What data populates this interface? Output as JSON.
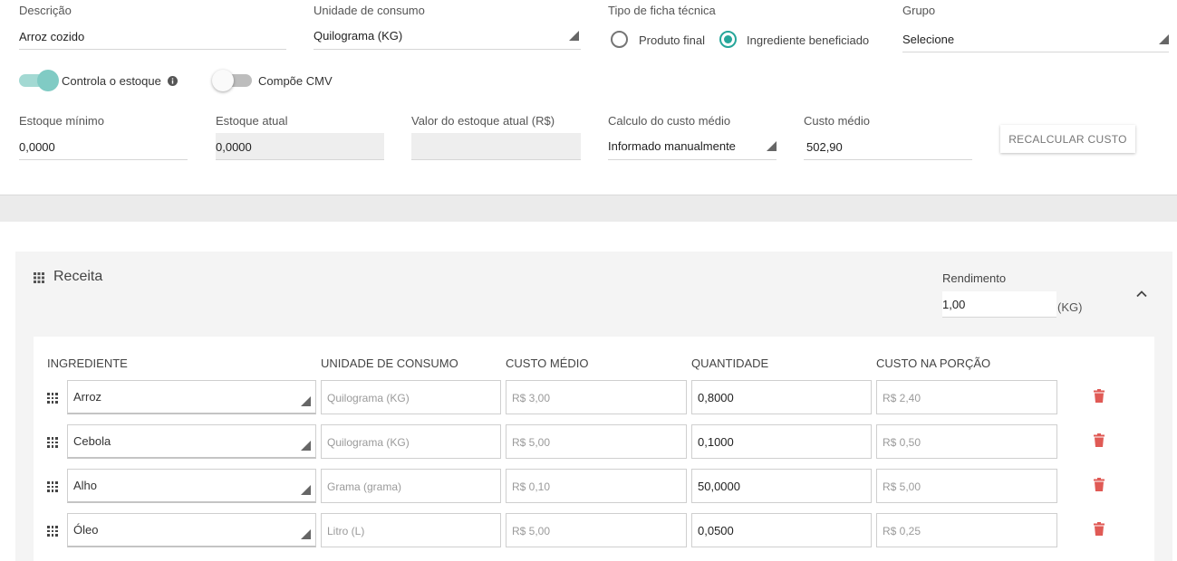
{
  "form": {
    "descricao_label": "Descrição",
    "descricao_value": "Arroz cozido",
    "unidade_label": "Unidade de consumo",
    "unidade_value": "Quilograma (KG)",
    "tipo_label": "Tipo de ficha técnica",
    "tipo_options": [
      "Produto final",
      "Ingrediente beneficiado"
    ],
    "tipo_selected": "Ingrediente beneficiado",
    "grupo_label": "Grupo",
    "grupo_value": "Selecione",
    "controla_label": "Controla o estoque",
    "controla_on": true,
    "compoe_label": "Compõe CMV",
    "compoe_on": false,
    "estoque_minimo_label": "Estoque mínimo",
    "estoque_minimo_value": "0,0000",
    "estoque_atual_label": "Estoque atual",
    "estoque_atual_value": "0,0000",
    "valor_estoque_label": "Valor do estoque atual (R$)",
    "valor_estoque_value": "",
    "calculo_label": "Calculo do custo médio",
    "calculo_value": "Informado manualmente",
    "custo_medio_label": "Custo médio",
    "custo_medio_value": "502,90",
    "recalcular_label": "RECALCULAR CUSTO"
  },
  "receita": {
    "title": "Receita",
    "rendimento_label": "Rendimento",
    "rendimento_value": "1,00",
    "rendimento_unit": "(KG)",
    "columns": [
      "INGREDIENTE",
      "UNIDADE DE CONSUMO",
      "CUSTO MÉDIO",
      "QUANTIDADE",
      "CUSTO NA PORÇÃO"
    ],
    "rows": [
      {
        "ingrediente": "Arroz",
        "unidade": "Quilograma (KG)",
        "custo_medio": "R$ 3,00",
        "quantidade": "0,8000",
        "custo_porcao": "R$ 2,40"
      },
      {
        "ingrediente": "Cebola",
        "unidade": "Quilograma (KG)",
        "custo_medio": "R$ 5,00",
        "quantidade": "0,1000",
        "custo_porcao": "R$ 0,50"
      },
      {
        "ingrediente": "Alho",
        "unidade": "Grama (grama)",
        "custo_medio": "R$ 0,10",
        "quantidade": "50,0000",
        "custo_porcao": "R$ 5,00"
      },
      {
        "ingrediente": "Óleo",
        "unidade": "Litro (L)",
        "custo_medio": "R$ 5,00",
        "quantidade": "0,0500",
        "custo_porcao": "R$ 0,25"
      }
    ]
  },
  "colors": {
    "accent": "#26a69a",
    "toggle_track_on": "#a3d9d3",
    "toggle_knob_on": "#80cbc4",
    "delete": "#e05a55"
  },
  "icons": {
    "select_caret": "triangle-caret-icon",
    "info": "info-icon",
    "drag": "drag-handle-icon",
    "collapse": "chevron-up-icon",
    "delete": "trash-icon"
  }
}
